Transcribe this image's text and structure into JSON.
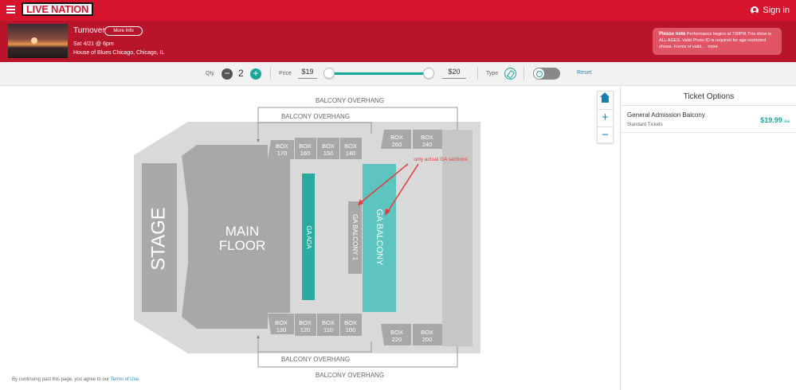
{
  "header": {
    "logo_text": "LIVE NATION",
    "signin_label": "Sign in"
  },
  "event": {
    "name": "Turnover",
    "more_info_label": "More Info",
    "date": "Sat 4/21 @ 6pm",
    "venue": "House of Blues Chicago, Chicago, IL",
    "note_title": "Please note",
    "note_text": "Performance begins at 730PM.This show is ALL AGES. Valid Photo ID is required for age restricted shows. Forms of valid...",
    "note_more": "more"
  },
  "filters": {
    "qty_label": "Qty",
    "qty_value": "2",
    "price_label": "Price",
    "price_min": "$19",
    "price_max": "$20",
    "type_label": "Type",
    "reset_label": "Reset"
  },
  "map": {
    "labels": {
      "stage": "STAGE",
      "main_floor_1": "MAIN",
      "main_floor_2": "FLOOR",
      "ga_ada": "GA ADA",
      "ga_balcony_1": "GA BALCONY 1",
      "ga_balcony": "GA BALCONY",
      "overhang": "BALCONY OVERHANG",
      "annotation": "only actual GA sections"
    },
    "boxes_top_left": [
      "170",
      "160",
      "150",
      "140"
    ],
    "boxes_top_right": [
      "260",
      "240"
    ],
    "boxes_bottom_left": [
      "130",
      "120",
      "110",
      "100"
    ],
    "boxes_bottom_right": [
      "220",
      "200"
    ],
    "box_prefix": "BOX",
    "colors": {
      "ga_section": "#5ec4c0",
      "ga_ada": "#2aa99e",
      "venue_base": "#d9d9d9",
      "section_gray": "#a8a8a8",
      "annotation": "#e23b3b"
    }
  },
  "footer": {
    "terms_prefix": "By continuing past this page, you agree to our ",
    "terms_link": "Terms of Use."
  },
  "ticket_panel": {
    "title": "Ticket Options",
    "offers": [
      {
        "name": "General Admission Balcony",
        "sub": "Standard Tickets",
        "price": "$19.99",
        "price_suffix": "ea"
      }
    ]
  }
}
